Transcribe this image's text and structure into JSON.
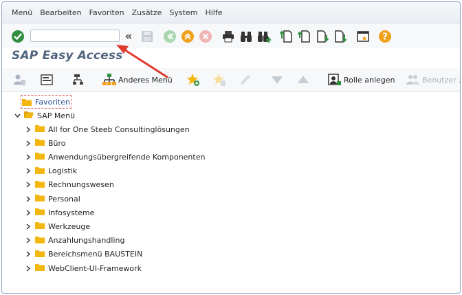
{
  "menubar": {
    "items": [
      "Menü",
      "Bearbeiten",
      "Favoriten",
      "Zusätze",
      "System",
      "Hilfe"
    ]
  },
  "toolbar": {
    "command_value": "",
    "collapse_glyph": "«"
  },
  "page": {
    "title": "SAP Easy Access"
  },
  "app_toolbar": {
    "other_menu_label": "Anderes Menü",
    "create_role_label": "Rolle anlegen",
    "assign_users_label": "Benutzer zu"
  },
  "tree": {
    "favorites_label": "Favoriten",
    "root_label": "SAP Menü",
    "items": [
      "All for One Steeb Consultinglösungen",
      "Büro",
      "Anwendungsübergreifende Komponenten",
      "Logistik",
      "Rechnungswesen",
      "Personal",
      "Infosysteme",
      "Werkzeuge",
      "Anzahlungshandling",
      "Bereichsmenü BAUSTEIN",
      "WebClient-UI-Framework"
    ]
  },
  "colors": {
    "accent_green": "#2f8f3f",
    "accent_orange": "#f0a11c",
    "annotation_red": "#e03a2f",
    "folder_yellow": "#f4b70f",
    "title_blue": "#50657d"
  }
}
